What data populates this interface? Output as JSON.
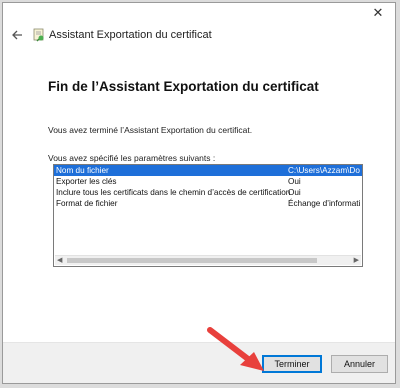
{
  "window": {
    "close_glyph": "✕",
    "title": "Assistant Exportation du certificat"
  },
  "content": {
    "heading": "Fin de l’Assistant Exportation du certificat",
    "done_text": "Vous avez terminé l’Assistant Exportation du certificat.",
    "params_label": "Vous avez spécifié les paramètres suivants :"
  },
  "params": [
    {
      "name": "Nom du fichier",
      "value": "C:\\Users\\Azzam\\Do",
      "selected": true
    },
    {
      "name": "Exporter les clés",
      "value": "Oui"
    },
    {
      "name": "Inclure tous les certificats dans le chemin d’accès de certification",
      "value": "Oui"
    },
    {
      "name": "Format de fichier",
      "value": "Échange d’informati"
    }
  ],
  "buttons": {
    "finish": "Terminer",
    "cancel": "Annuler"
  },
  "colors": {
    "selection": "#1e6fd9",
    "annotation_arrow": "#e8403c",
    "focus_border": "#0078d7"
  },
  "icons": {
    "back": "back-arrow-icon",
    "wizard": "certificate-icon",
    "annotation": "red-arrow-annotation"
  }
}
